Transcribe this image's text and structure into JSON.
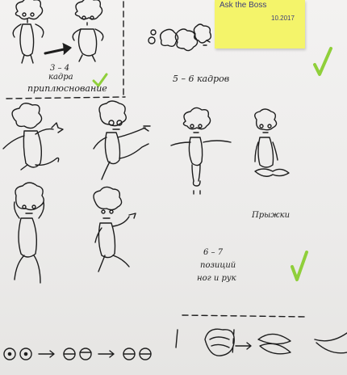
{
  "sticky_note": {
    "title": "Ask the Boss",
    "date": "10.2017"
  },
  "labels": {
    "frames_3_4_num": "3 – 4",
    "frames_3_4_word": "кадра",
    "squash_label": "приплюснование",
    "frames_5_6": "5 – 6 кадров",
    "jumps": "Прыжки",
    "poses_num": "6 – 7",
    "poses_line1": "позиций",
    "poses_line2": "ног и рук"
  },
  "colors": {
    "ink": "#1d1d1d",
    "sticky": "#f4f46a",
    "check": "#8fcf3a",
    "paper": "#f1f0ef"
  }
}
